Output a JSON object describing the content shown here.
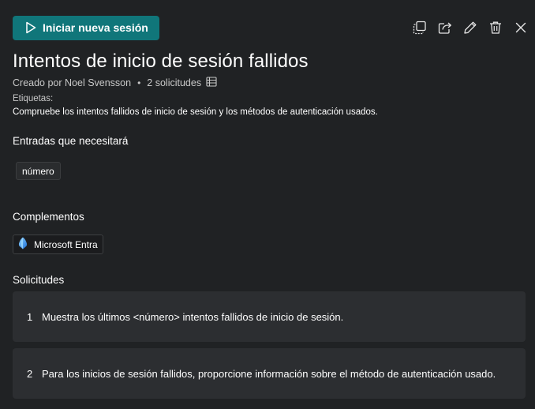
{
  "header": {
    "start_button_label": "Iniciar nueva sesión",
    "toolbar": [
      {
        "name": "duplicate-icon"
      },
      {
        "name": "share-icon"
      },
      {
        "name": "edit-icon"
      },
      {
        "name": "delete-icon"
      },
      {
        "name": "close-icon"
      }
    ]
  },
  "promptbook": {
    "title": "Intentos de inicio de sesión fallidos",
    "created_by": "Creado por Noel Svensson",
    "prompt_count": "2 solicitudes",
    "tags_label": "Etiquetas:",
    "description": "Compruebe los intentos fallidos de inicio de sesión y los métodos de autenticación usados."
  },
  "inputs": {
    "heading": "Entradas que necesitará",
    "items": [
      "número"
    ]
  },
  "plugins": {
    "heading": "Complementos",
    "items": [
      "Microsoft Entra"
    ]
  },
  "prompts": {
    "heading": "Solicitudes",
    "items": [
      {
        "number": "1",
        "text": "Muestra los últimos <número> intentos fallidos de inicio de sesión."
      },
      {
        "number": "2",
        "text": "Para los inicios de sesión fallidos, proporcione información sobre el método de autenticación usado."
      }
    ]
  },
  "colors": {
    "background": "#202224",
    "accent": "#10767a",
    "card": "#2c2e31",
    "muted_text": "#c9c9c9"
  }
}
